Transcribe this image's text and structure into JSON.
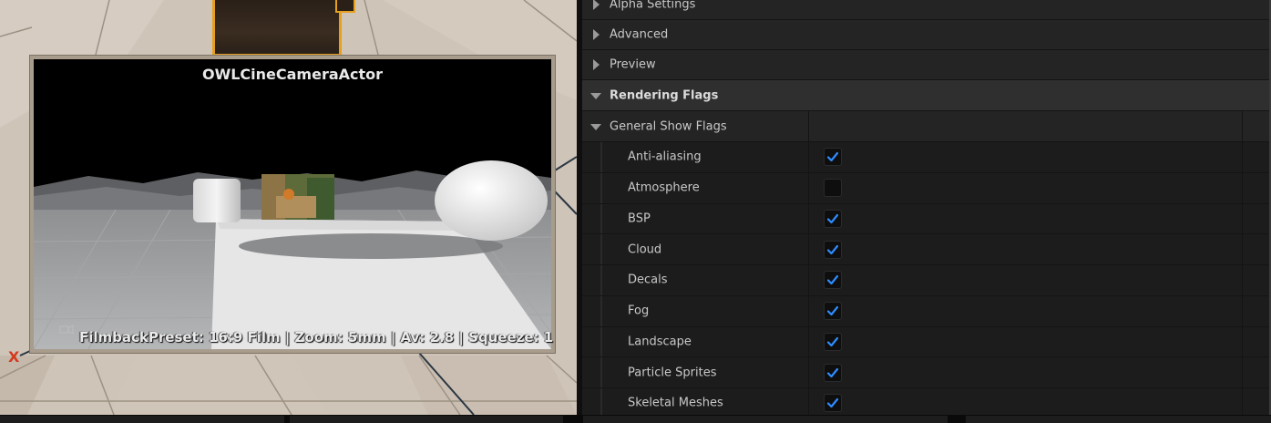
{
  "viewport": {
    "pip_title": "OWLCineCameraActor",
    "pip_info": "FilmbackPreset: 16:9 Film | Zoom: 5mm | Av: 2.8 | Squeeze: 1",
    "axis_label": "X",
    "colors": {
      "camera_outline": "#e6a020",
      "axis_x": "#d43a1e"
    }
  },
  "details": {
    "rows": [
      {
        "label": "Alpha Settings",
        "kind": "collapsed"
      },
      {
        "label": "Advanced",
        "kind": "collapsed"
      },
      {
        "label": "Preview",
        "kind": "collapsed"
      },
      {
        "label": "Rendering Flags",
        "kind": "category-expanded"
      },
      {
        "label": "General Show Flags",
        "kind": "expanded"
      }
    ],
    "flags": [
      {
        "label": "Anti-aliasing",
        "checked": true
      },
      {
        "label": "Atmosphere",
        "checked": false
      },
      {
        "label": "BSP",
        "checked": true
      },
      {
        "label": "Cloud",
        "checked": true
      },
      {
        "label": "Decals",
        "checked": true
      },
      {
        "label": "Fog",
        "checked": true
      },
      {
        "label": "Landscape",
        "checked": true
      },
      {
        "label": "Particle Sprites",
        "checked": true
      },
      {
        "label": "Skeletal Meshes",
        "checked": true
      }
    ],
    "colors": {
      "check": "#2f8cff"
    }
  }
}
